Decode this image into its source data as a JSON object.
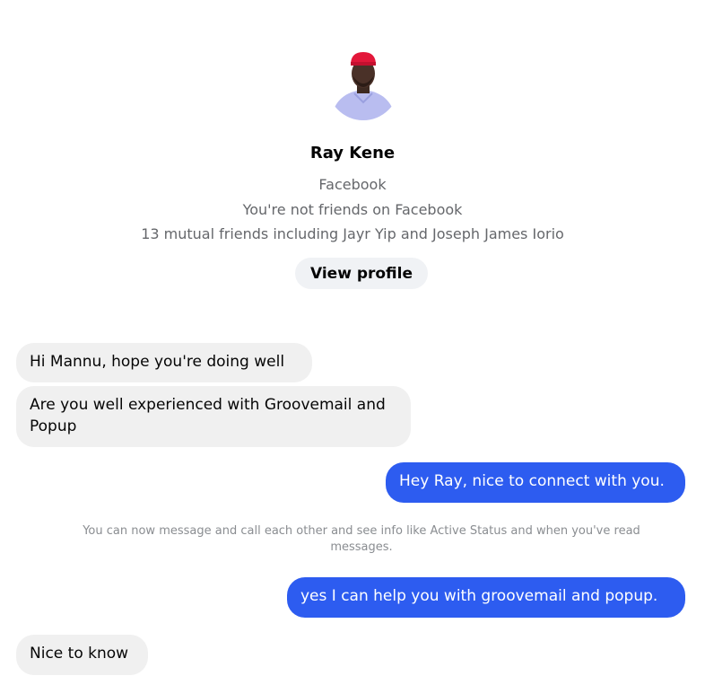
{
  "profile": {
    "name": "Ray Kene",
    "source": "Facebook",
    "friend_status": "You're not friends on Facebook",
    "mutual_friends": "13 mutual friends including Jayr Yip and Joseph James Iorio",
    "view_profile_label": "View profile"
  },
  "messages": [
    {
      "direction": "incoming",
      "text": "Hi Mannu, hope you're doing well"
    },
    {
      "direction": "incoming",
      "text": "Are you well experienced with Groovemail and Popup"
    },
    {
      "direction": "outgoing",
      "text": "Hey Ray, nice to connect with you."
    },
    {
      "direction": "system",
      "text": "You can now message and call each other and see info like Active Status and when you've read messages."
    },
    {
      "direction": "outgoing",
      "text": "yes I can help you with groovemail and popup."
    },
    {
      "direction": "incoming",
      "text": "Nice to know"
    }
  ],
  "colors": {
    "outgoing_bubble": "#2d5cf0",
    "incoming_bubble": "#f0f0f0",
    "secondary_text": "#65676b"
  }
}
